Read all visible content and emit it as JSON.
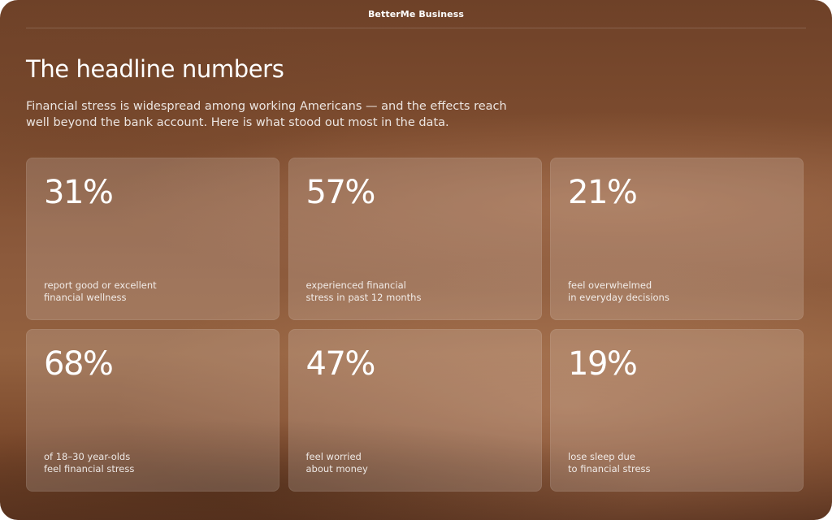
{
  "header": {
    "brand": "BetterMe Business"
  },
  "main": {
    "title": "The headline numbers",
    "intro": "Financial stress is widespread among working Americans — and the effects reach well beyond the bank account. Here is what stood out most in the data.",
    "stats": [
      {
        "value": "31%",
        "line1": "report good or excellent",
        "line2": "financial wellness"
      },
      {
        "value": "57%",
        "line1": "experienced financial",
        "line2": "stress in past 12 months"
      },
      {
        "value": "21%",
        "line1": "feel overwhelmed",
        "line2": "in everyday decisions"
      },
      {
        "value": "68%",
        "line1": "of 18–30 year-olds",
        "line2": "feel financial stress"
      },
      {
        "value": "47%",
        "line1": "feel worried",
        "line2": "about money"
      },
      {
        "value": "19%",
        "line1": "lose sleep due",
        "line2": "to financial stress"
      }
    ]
  }
}
